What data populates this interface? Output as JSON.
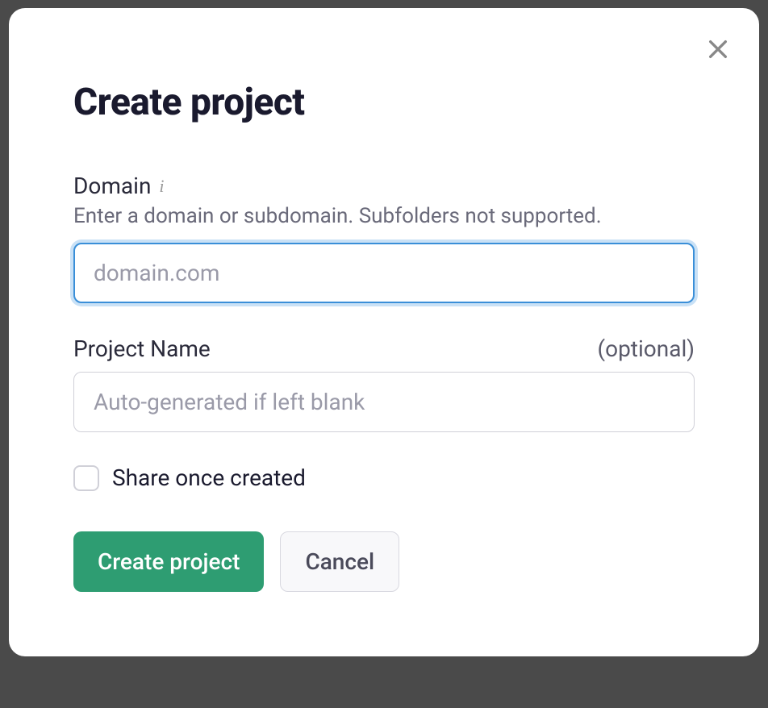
{
  "modal": {
    "title": "Create project",
    "domain": {
      "label": "Domain",
      "help_text": "Enter a domain or subdomain. Subfolders not supported.",
      "placeholder": "domain.com",
      "value": ""
    },
    "project_name": {
      "label": "Project Name",
      "optional_label": "(optional)",
      "placeholder": "Auto-generated if left blank",
      "value": ""
    },
    "share_checkbox": {
      "label": "Share once created",
      "checked": false
    },
    "buttons": {
      "create_label": "Create project",
      "cancel_label": "Cancel"
    }
  }
}
